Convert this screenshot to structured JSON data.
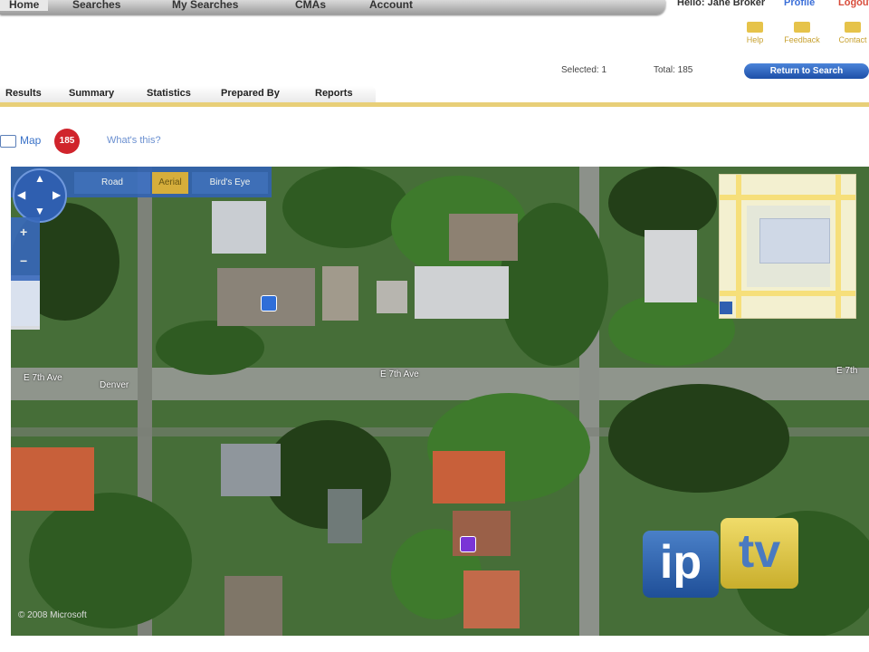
{
  "top_nav": {
    "tabs": [
      "Home",
      "Searches",
      "My Searches",
      "CMAs",
      "Account"
    ],
    "user": "Hello: Jane Broker",
    "links": [
      "Profile",
      "Logout"
    ]
  },
  "toolbar": {
    "tools": [
      "Help",
      "Feedback",
      "Contact"
    ]
  },
  "status": {
    "selected_label": "Selected: 1",
    "total_label": "Total: 185",
    "return_button": "Return to Search"
  },
  "sub_tabs": [
    "Results",
    "Summary",
    "Statistics",
    "Prepared By",
    "Reports"
  ],
  "map_header": {
    "label": "Map",
    "badge": "185",
    "whats_this": "What's this?"
  },
  "map": {
    "mode_buttons": [
      "Road",
      "Aerial",
      "Bird's Eye"
    ],
    "street_labels": [
      "E 7th Ave",
      "Denver",
      "E 7th Ave",
      "E 7th"
    ],
    "copyright": "© 2008 Microsoft"
  },
  "logo": {
    "left": "ip",
    "right": "tv"
  },
  "colors": {
    "accent_blue": "#3363b0",
    "gold_line": "#e8cf78",
    "badge_red": "#d0242c",
    "aerial_green": "#466e38",
    "roof_orange": "#c8603a"
  }
}
